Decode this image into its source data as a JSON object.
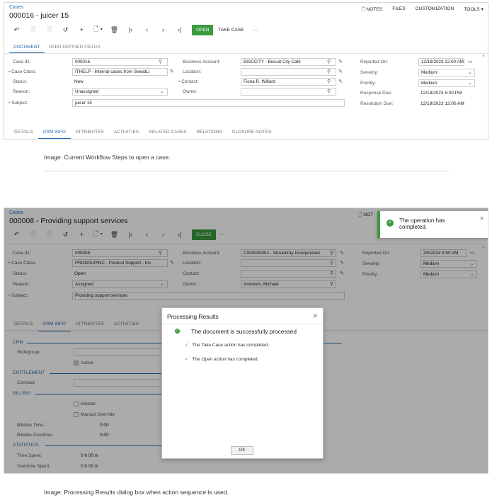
{
  "shot1": {
    "breadcrumb": "Cases",
    "title": "000016 - juicer 15",
    "topright": [
      "NOTES",
      "FILES",
      "CUSTOMIZATION",
      "TOOLS ▾"
    ],
    "toolbar": {
      "icons": [
        "↶",
        "🗎",
        "🗎",
        "↺",
        "+",
        "🗋 ▾",
        "🗑",
        "|‹",
        "‹",
        "›",
        "›|"
      ],
      "primary": "OPEN",
      "secondary": "TAKE CASE",
      "more": "···"
    },
    "tabs_top": [
      "DOCUMENT",
      "USER-DEFINED FIELDS"
    ],
    "fields": {
      "case_id_label": "Case ID:",
      "case_id": "000016",
      "case_class_label": "Case Class:",
      "case_class": "ITHELP - Internal cases from SweatLi",
      "status_label": "Status:",
      "status": "New",
      "reason_label": "Reason:",
      "reason": "Unassigned",
      "subject_label": "Subject:",
      "subject": "juicer 15",
      "business_account_label": "Business Account:",
      "business_account": "BISCCITY - Biscuit City Café",
      "location_label": "Location:",
      "location": "",
      "contact_label": "Contact:",
      "contact": "Fiona R. Willard",
      "owner_label": "Owner:",
      "owner": "",
      "reported_on_label": "Reported On:",
      "reported_on": "12/18/2023 12:00 AM",
      "severity_label": "Severity:",
      "severity": "Medium",
      "priority_label": "Priority:",
      "priority": "Medium",
      "response_due_label": "Response Due:",
      "response_due": "12/18/2023 5:00 PM",
      "resolution_due_label": "Resolution Due:",
      "resolution_due": "12/18/2023 12:00 AM"
    },
    "tabs_bottom": [
      "DETAILS",
      "CRM INFO",
      "ATTRIBUTES",
      "ACTIVITIES",
      "RELATED CASES",
      "RELATIONS",
      "CLOSURE NOTES"
    ]
  },
  "caption1": "Image: Current Workflow Steps to open a case.",
  "shot2": {
    "breadcrumb": "Cases",
    "title": "000008 - Providing support services",
    "notes": "NOT",
    "toolbar": {
      "icons": [
        "↶",
        "🗎",
        "🗎",
        "↺",
        "+",
        "🗋 ▾",
        "🗑",
        "|‹",
        "‹",
        "›",
        "›|"
      ],
      "primary": "CLOSE",
      "more": "···"
    },
    "fields": {
      "case_id_label": "Case ID:",
      "case_id": "000008",
      "case_class_label": "Case Class:",
      "case_class": "PRODSUPINC - Product Support - Inc",
      "status_label": "Status:",
      "status": "Open",
      "reason_label": "Reason:",
      "reason": "Assigned",
      "subject_label": "Subject:",
      "subject": "Providing support services",
      "business_account_label": "Business Account:",
      "business_account": "C000000052 - Streamray Incorporated",
      "location_label": "Location:",
      "contact_label": "Contact:",
      "owner_label": "Owner:",
      "owner": "Andrews, Michael",
      "reported_on_label": "Reported On:",
      "reported_on": "3/5/2024 9:50 AM",
      "severity_label": "Severity:",
      "severity": "Medium",
      "priority_label": "Priority:",
      "priority": "Medium"
    },
    "tabs_bottom": [
      "DETAILS",
      "CRM INFO",
      "ATTRIBUTES",
      "ACTIVITIES"
    ],
    "crm": {
      "crm_section": "CRM",
      "workgroup_label": "Workgroup:",
      "active_label": "Active",
      "entitlement_section": "ENTITLEMENT",
      "contract_label": "Contract:",
      "billing_section": "BILLING",
      "billable_label": "Billable",
      "manual_override_label": "Manual Override",
      "billable_time_label": "Billable Time:",
      "billable_time": "0:00",
      "billable_overtime_label": "Billable Overtime:",
      "billable_overtime": "0:00",
      "statistics_section": "STATISTICS",
      "time_spent_label": "Time Spent:",
      "time_spent": "0 h 00 m",
      "overtime_spent_label": "Overtime Spent:",
      "overtime_spent": "0 h 00 m"
    },
    "dialog": {
      "title": "Processing Results",
      "main": "The document is successfully processed",
      "row1": "The Take Case action has completed.",
      "row2": "The Open action has completed.",
      "ok": "OK"
    },
    "toast": {
      "message": "The operation has completed."
    }
  },
  "caption2": "Image: Processing Results dialog box when action sequence is used.",
  "colors": {
    "accent": "#2b6cb0",
    "success": "#3a9a3e"
  }
}
